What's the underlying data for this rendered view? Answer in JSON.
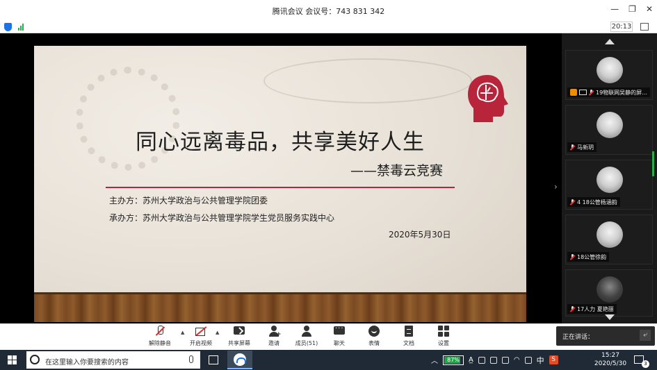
{
  "window": {
    "title": "腾讯会议  会议号：743 831 342",
    "min_icon": "—",
    "restore_icon": "❐",
    "close_icon": "✕"
  },
  "statusbar": {
    "timer": "20:13"
  },
  "slide": {
    "title": "同心远离毒品，共享美好人生",
    "subtitle": "——禁毒云竞赛",
    "organizer": "主办方：苏州大学政治与公共管理学院团委",
    "co_organizer": "承办方：苏州大学政治与公共管理学院学生党员服务实践中心",
    "date": "2020年5月30日",
    "brain_color": "#b8243a"
  },
  "participants": [
    {
      "label": "19物联网吴静的屏..."
    },
    {
      "label": "马新玥"
    },
    {
      "label": "4  18公管杨涵韵"
    },
    {
      "label": "18公管徐韵"
    },
    {
      "label": "17人力  夏艳丽"
    }
  ],
  "toolbar": {
    "unmute": "解除静音",
    "start_video": "开启视频",
    "share_screen": "共享屏幕",
    "invite": "邀请",
    "members": "成员(51)",
    "chat": "聊天",
    "emoji": "表情",
    "docs": "文档",
    "settings": "设置",
    "caret": "▲"
  },
  "speaking": {
    "label": "正在讲话：",
    "back_icon": "⤶"
  },
  "taskbar": {
    "search_placeholder": "在这里输入你要搜索的内容",
    "battery": "87%",
    "battery_level": 0.87,
    "ime": "中",
    "sogou": "S",
    "time": "15:27",
    "date": "2020/5/30",
    "notif_count": "3",
    "tray_up": "︿",
    "ai": "A̲",
    "wifi": "◠"
  }
}
